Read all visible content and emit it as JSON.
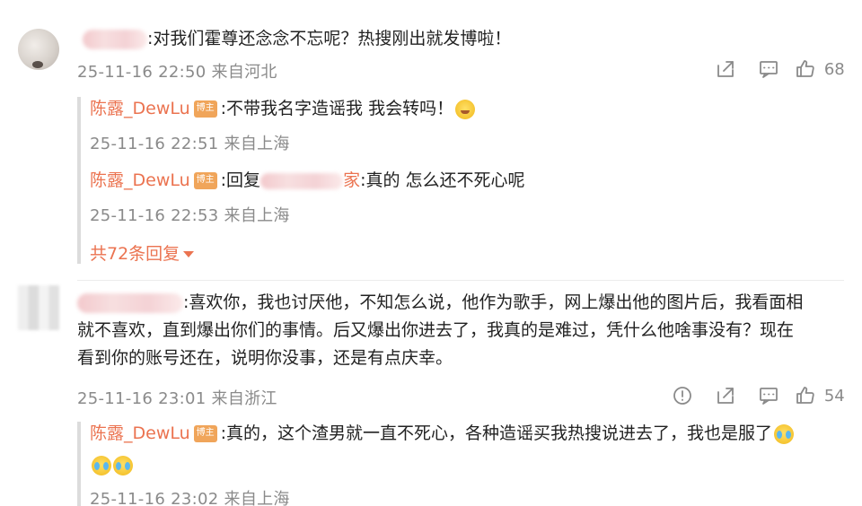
{
  "comments": [
    {
      "text": ":对我们霍尊还念念不忘呢？热搜刚出就发博啦！",
      "meta": "25-11-16 22:50 来自河北",
      "likes": "68",
      "replies": [
        {
          "name": "陈露_DewLu",
          "badge": "博主",
          "text": ":不带我名字造谣我 我会转吗！",
          "meta": "25-11-16 22:51 来自上海"
        },
        {
          "name": "陈露_DewLu",
          "badge": "博主",
          "text_pre": ":回复",
          "text_tail": "家",
          "text_post": ":真的 怎么还不死心呢",
          "meta": "25-11-16 22:53 来自上海"
        }
      ],
      "more_replies": "共72条回复"
    },
    {
      "text_line1": ":喜欢你，我也讨厌他，不知怎么说，他作为歌手，网上爆出他的图片后，我看面相",
      "text_line2": "就不喜欢，直到爆出你们的事情。后又爆出你进去了，我真的是难过，凭什么他啥事没有？现在",
      "text_line3": "看到你的账号还在，说明你没事，还是有点庆幸。",
      "meta": "25-11-16 23:01 来自浙江",
      "likes": "54",
      "replies": [
        {
          "name": "陈露_DewLu",
          "badge": "博主",
          "text": ":真的，这个渣男就一直不死心，各种造谣买我热搜说进去了，我也是服了",
          "meta": "25-11-16 23:02 来自上海"
        }
      ]
    }
  ],
  "icons": {
    "share": "share-icon",
    "comment": "comment-icon",
    "like": "like-icon",
    "report": "report-icon",
    "emoji_cute": "smirk-emoji",
    "emoji_cry": "laugh-cry-emoji"
  },
  "colors": {
    "username": "#eb7350",
    "badge": "#f0a55a",
    "meta": "#8a8a8a"
  }
}
